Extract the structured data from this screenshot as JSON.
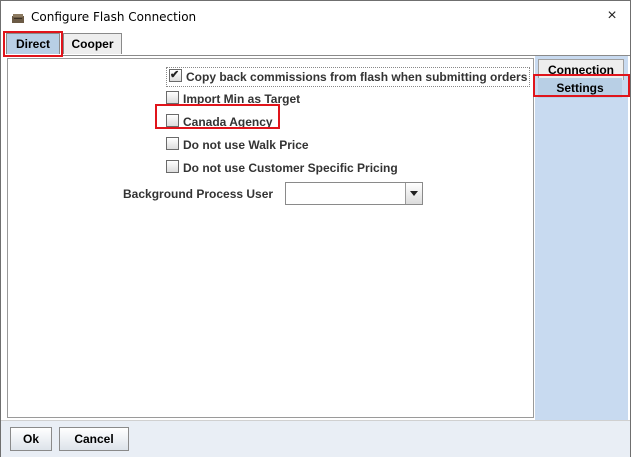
{
  "window": {
    "title": "Configure Flash Connection",
    "close_glyph": "×"
  },
  "tabs": [
    {
      "label": "Direct",
      "active": true
    },
    {
      "label": "Cooper",
      "active": false
    }
  ],
  "side_tabs": [
    {
      "label": "Connection",
      "active": false
    },
    {
      "label": "Settings",
      "active": true
    }
  ],
  "settings": {
    "checkboxes": [
      {
        "label": "Copy back commissions from flash when submitting orders",
        "checked": true
      },
      {
        "label": "Import Min as Target",
        "checked": false
      },
      {
        "label": "Canada Agency",
        "checked": false
      },
      {
        "label": "Do not use Walk Price",
        "checked": false
      },
      {
        "label": "Do not use Customer Specific Pricing",
        "checked": false
      }
    ],
    "background_process_user": {
      "label": "Background Process User",
      "value": ""
    }
  },
  "footer": {
    "ok_label": "Ok",
    "cancel_label": "Cancel"
  },
  "colors": {
    "highlight": "#e0141b",
    "active_tab": "#b8cfe5",
    "side_panel": "#c8daf0"
  },
  "icons": {
    "app": "flash-app-icon",
    "close": "close-icon",
    "dropdown": "chevron-down-icon",
    "check": "checkmark-icon"
  }
}
